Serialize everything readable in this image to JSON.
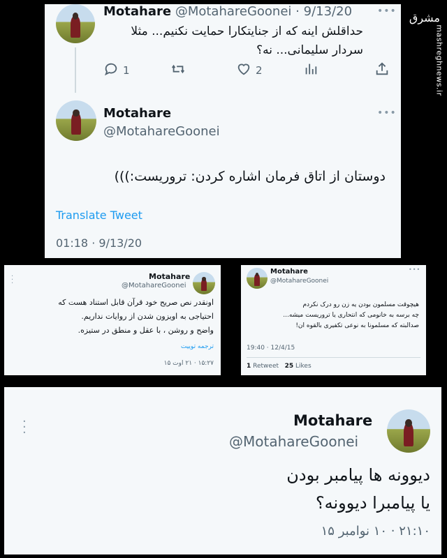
{
  "watermark": {
    "logo": "مشرق",
    "site": "mashreghnews.ir"
  },
  "card1": {
    "reply": {
      "name": "Motahare",
      "handle": "@MotahareGoonei",
      "date": "9/13/20",
      "separator": "·",
      "text_line1": "حداقلش اینه که از جنایتکارا حمایت نکنیم... مثلا",
      "text_line2": "سردار سلیمانی... نه؟",
      "replies": "1",
      "likes": "2"
    },
    "main": {
      "name": "Motahare",
      "handle": "@MotahareGoonei",
      "text": "دوستان از اتاق فرمان اشاره کردن: تروریست:)))",
      "translate": "Translate Tweet",
      "timestamp": "01:18 · 9/13/20"
    }
  },
  "card2": {
    "name": "Motahare",
    "handle": "@MotahareGoonei",
    "line1": "اونقدر نص صریح خود قرآن قابل استناد هست که",
    "line2": "احتیاجی به اویزون شدن از روایات نداریم.",
    "line3": "واضح و روشن ، با عقل و منطق در ستیزه.",
    "translate": "ترجمه توییت",
    "timestamp": "۱۵:۲۷ · ۲۱ اوت ۱۵"
  },
  "card3": {
    "name": "Motahare",
    "handle": "@MotahareGoonei",
    "line1": "هیچوقت مسلمون بودن یه زن رو درک نکردم",
    "line2": "چه برسه به خانومی که انتحاری یا تروریست میشه...",
    "line3": "صدالبته که مسلمونا به نوعی تکفیری بالقوه ان!",
    "timestamp": "19:40 · 12/4/15",
    "retweets_count": "1",
    "retweets_label": "Retweet",
    "likes_count": "25",
    "likes_label": "Likes"
  },
  "card4": {
    "name": "Motahare",
    "handle": "@MotahareGoonei",
    "line1": "دیوونه ها پیامبر بودن",
    "line2": "یا پیامبرا دیوونه؟",
    "timestamp": "۲۱:۱۰ · ۱۰ نوامبر ۱۵"
  }
}
